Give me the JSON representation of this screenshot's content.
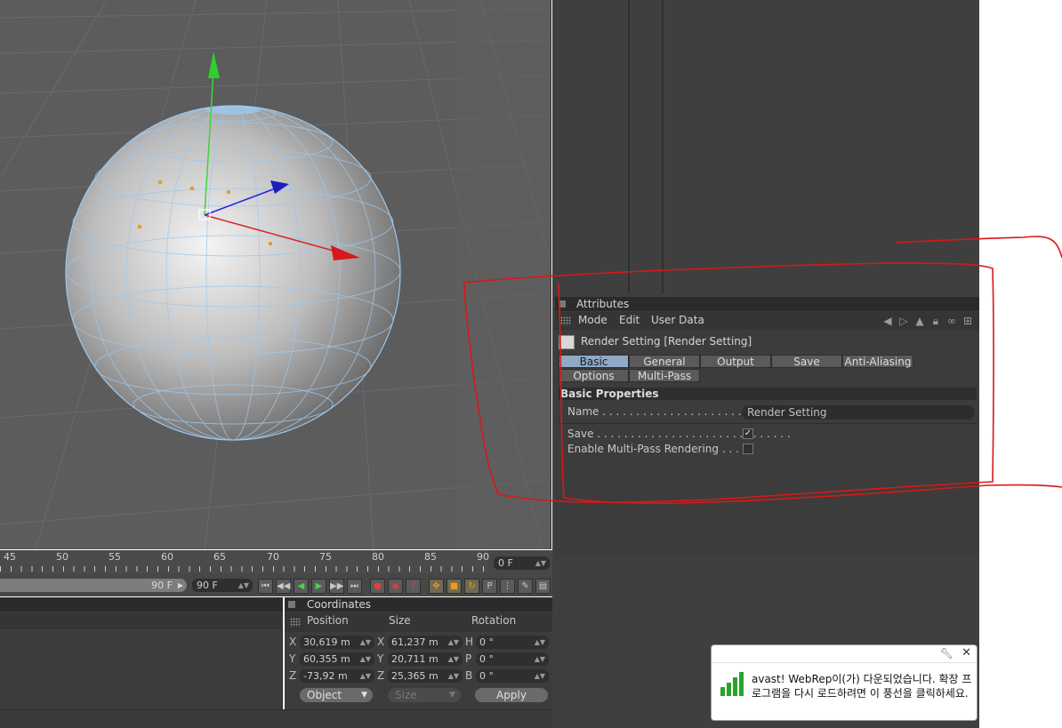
{
  "attributes": {
    "title": "Attributes",
    "menu": [
      "Mode",
      "Edit",
      "User Data"
    ],
    "object_title": "Render Setting [Render Setting]",
    "tabs_row1": [
      "Basic",
      "General",
      "Output",
      "Save",
      "Anti-Aliasing"
    ],
    "tabs_row2": [
      "Options",
      "Multi-Pass"
    ],
    "active_tab": "Basic",
    "section": "Basic Properties",
    "name_label": "Name . . . . . . . . . . . . . . . . . . . . . . . . . . . .",
    "name_value": "Render Setting",
    "save_label": "Save . . . . . . . . . . . . . . . . . . . . . . . . . . . . .",
    "save_checked": true,
    "multipass_label": "Enable Multi-Pass Rendering . . . .",
    "multipass_checked": false
  },
  "timeline": {
    "ticks": [
      "45",
      "50",
      "55",
      "60",
      "65",
      "70",
      "75",
      "80",
      "85",
      "90"
    ],
    "current_frame": "0 F",
    "end_frame_bar": "90 F",
    "end_frame_field": "90 F"
  },
  "coordinates": {
    "title": "Coordinates",
    "col_position": "Position",
    "col_size": "Size",
    "col_rotation": "Rotation",
    "rows": [
      {
        "pos_axis": "X",
        "pos": "30,619 m",
        "size_axis": "X",
        "size": "61,237 m",
        "rot_axis": "H",
        "rot": "0 °"
      },
      {
        "pos_axis": "Y",
        "pos": "60,355 m",
        "size_axis": "Y",
        "size": "20,711 m",
        "rot_axis": "P",
        "rot": "0 °"
      },
      {
        "pos_axis": "Z",
        "pos": "-73,92 m",
        "size_axis": "Z",
        "size": "25,365 m",
        "rot_axis": "B",
        "rot": "0 °"
      }
    ],
    "mode_dropdown": "Object",
    "size_dropdown": "Size",
    "apply_label": "Apply"
  },
  "avast": {
    "message": "avast! WebRep이(가) 다운되었습니다. 확장 프로그램을 다시 로드하려면 이 풍선을 클릭하세요."
  },
  "colors": {
    "viewport_bg": "#5c5c5c",
    "panel_bg": "#3c3c3c",
    "active_tab": "#8fa9c6",
    "annotation_red": "#d81818"
  }
}
